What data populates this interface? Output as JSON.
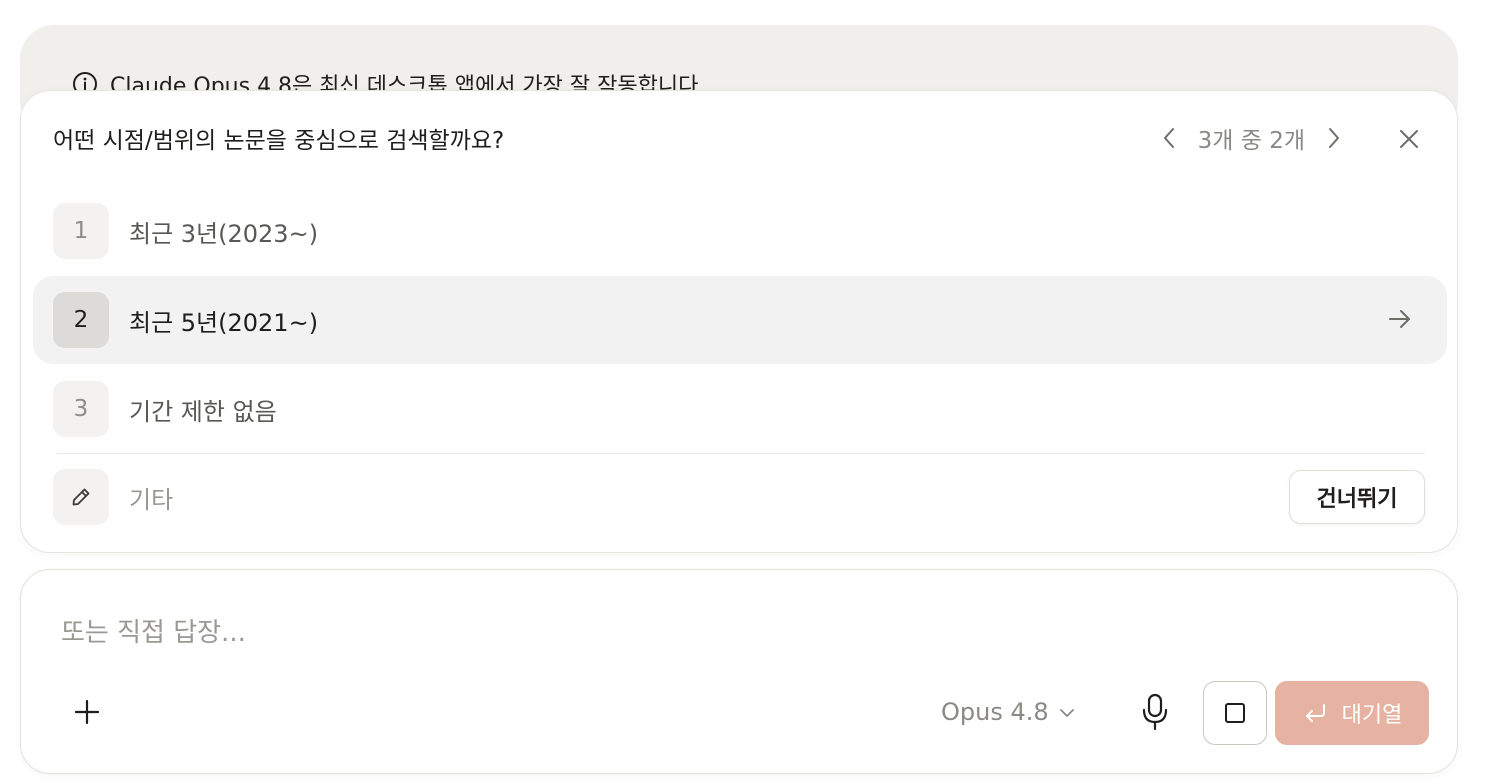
{
  "banner": {
    "icon": "info-icon",
    "text": "Claude Opus 4.8은 최신 데스크톱 앱에서 가장 잘 작동합니다."
  },
  "question": {
    "title": "어떤 시점/범위의 논문을 중심으로 검색할까요?",
    "pager_text": "3개 중 2개",
    "current_index": 2,
    "total": 3
  },
  "options": [
    {
      "number": "1",
      "label": "최근 3년(2023~)",
      "selected": false
    },
    {
      "number": "2",
      "label": "최근 5년(2021~)",
      "selected": true
    },
    {
      "number": "3",
      "label": "기간 제한 없음",
      "selected": false
    }
  ],
  "other": {
    "label": "기타",
    "icon": "pencil-icon"
  },
  "skip_label": "건너뛰기",
  "composer": {
    "placeholder": "또는 직접 답장...",
    "model": "Opus 4.8",
    "queue_label": "대기열"
  },
  "colors": {
    "banner_bg": "#f0efec",
    "selected_bg": "#f3f2f2",
    "queue_button": "#e6b3a2",
    "text": "#1f1e1d",
    "muted": "#8b8984"
  }
}
